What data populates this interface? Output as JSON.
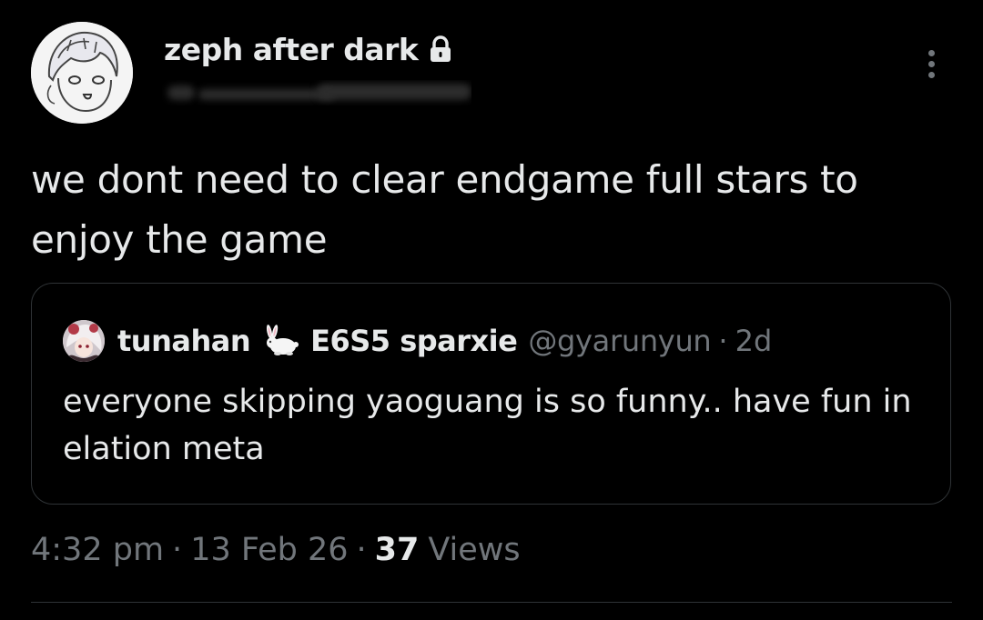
{
  "author": {
    "display_name": "zeph after dark",
    "avatar_icon": "anime-sketch-avatar-icon",
    "protected_icon": "lock-icon",
    "handle_redacted": true
  },
  "tweet": {
    "text": "we dont need to clear endgame full stars to enjoy the game"
  },
  "quote": {
    "avatar_icon": "anime-avatar-icon",
    "name_part1": "tunahan",
    "name_emoji": "rabbit-icon",
    "name_part2": "E6S5 sparxie",
    "handle": "@gyarunyun",
    "separator": "·",
    "time_ago": "2d",
    "text": "everyone skipping yaoguang is so funny.. have fun in elation meta"
  },
  "meta": {
    "time": "4:32 pm",
    "separator1": "·",
    "date": "13 Feb 26",
    "separator2": "·",
    "views_count": "37",
    "views_label": "Views"
  },
  "colors": {
    "background": "#000000",
    "text_primary": "#e7e9ea",
    "text_secondary": "#71767b",
    "border": "#2f3336"
  }
}
